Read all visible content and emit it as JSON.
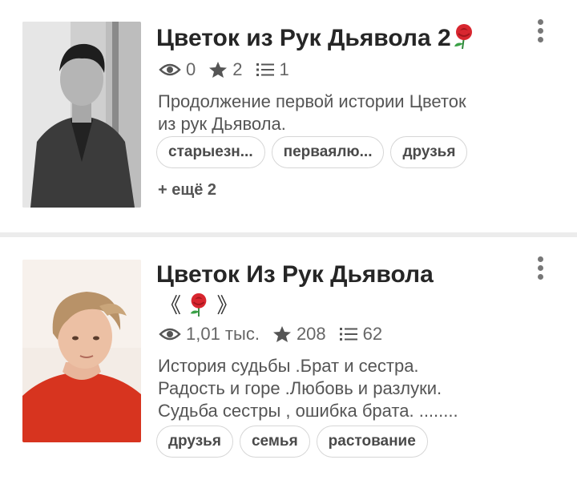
{
  "stories": [
    {
      "title": "Цветок из Рук Дьявола 2",
      "title_emoji": "rose",
      "views": "0",
      "votes": "2",
      "parts": "1",
      "description_lines": [
        "Продолжение первой истории Цветок",
        "из рук Дьявола."
      ],
      "tags": [
        "старыезн...",
        "перваялю...",
        "друзья"
      ],
      "more_tags": "+ ещё 2"
    },
    {
      "title": "Цветок Из Рук Дьявола",
      "title_line2_left": "《",
      "title_line2_emoji": "rose",
      "title_line2_right": "》",
      "views": "1,01 тыс.",
      "votes": "208",
      "parts": "62",
      "description_lines": [
        "История судьбы .Брат и сестра.",
        "Радость и горе .Любовь и разлуки.",
        "Судьба сестры , ошибка брата. ........"
      ],
      "tags": [
        "друзья",
        "семья",
        "растование"
      ]
    }
  ],
  "icons": {
    "views": "eye-icon",
    "votes": "star-icon",
    "parts": "list-icon",
    "menu": "more-vertical-icon"
  },
  "colors": {
    "background": "#ececec",
    "card": "#ffffff",
    "text": "#262626",
    "muted": "#666666",
    "rose": "#d8262f"
  }
}
